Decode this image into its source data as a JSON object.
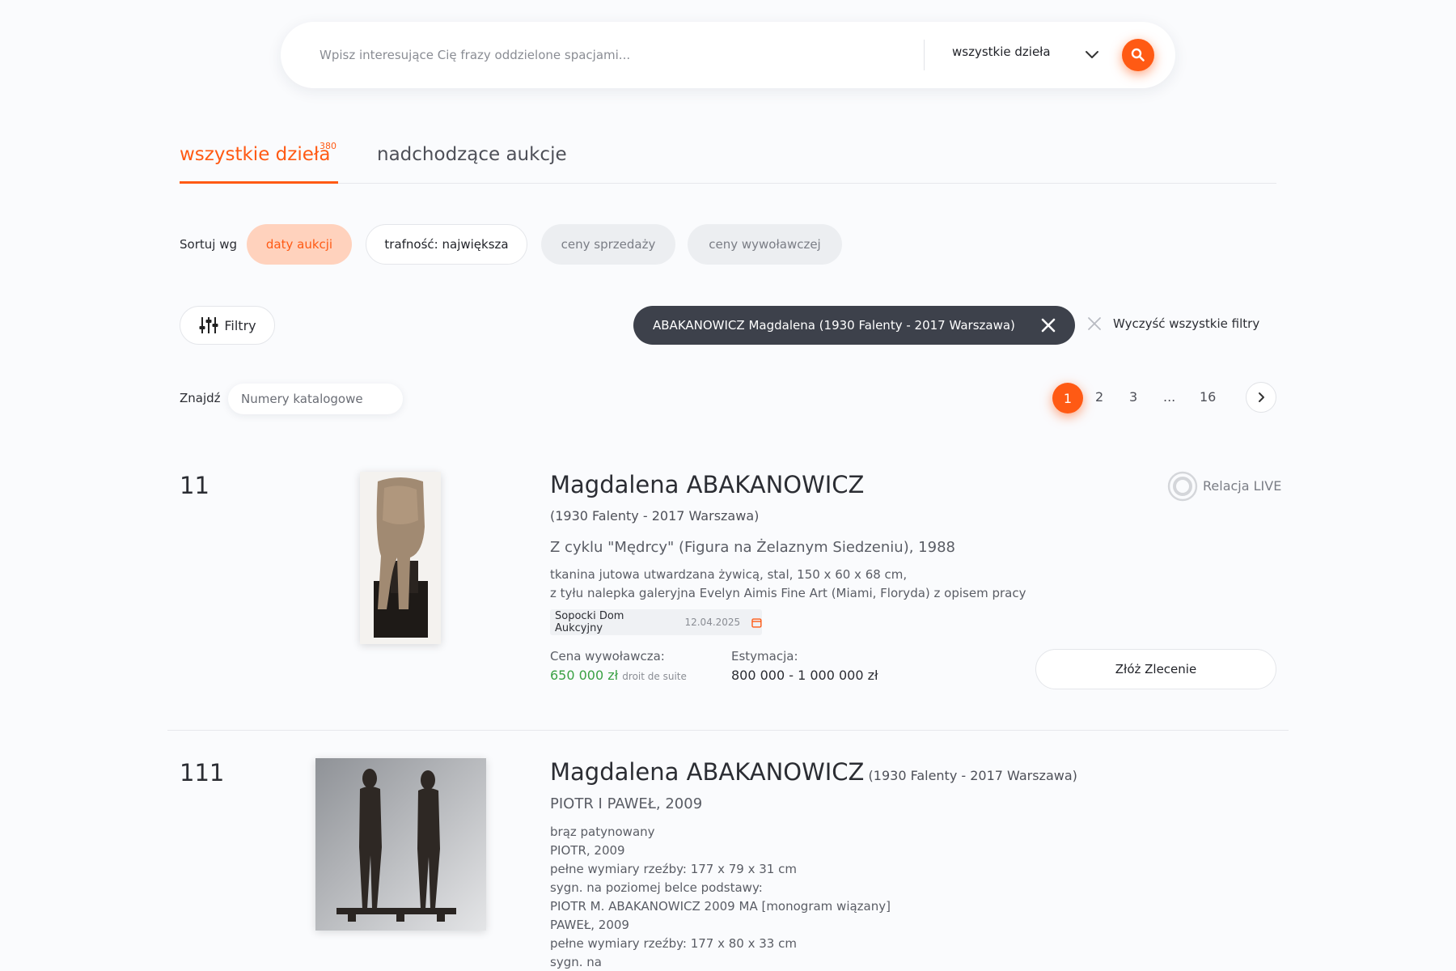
{
  "search": {
    "placeholder": "Wpisz interesujące Cię frazy oddzielone spacjami...",
    "category": "wszystkie dzieła"
  },
  "tabs": [
    {
      "label": "wszystkie dzieła",
      "count": "380",
      "active": true
    },
    {
      "label": "nadchodzące aukcje",
      "active": false
    }
  ],
  "sort": {
    "label": "Sortuj wg",
    "options": [
      {
        "label": "daty aukcji",
        "active": true
      },
      {
        "label": "trafność: największa"
      },
      {
        "label": "ceny sprzedaży"
      },
      {
        "label": "ceny wywoławczej"
      }
    ]
  },
  "filters": {
    "button_label": "Filtry",
    "active_filter": "ABAKANOWICZ Magdalena (1930 Falenty - 2017 Warszawa)",
    "clear_label": "Wyczyść wszystkie filtry"
  },
  "find": {
    "label": "Znajdź",
    "placeholder": "Numery katalogowe"
  },
  "pagination": {
    "current": "1",
    "pages": [
      "2",
      "3",
      "...",
      "16"
    ]
  },
  "listings": [
    {
      "lot": "11",
      "artist": "Magdalena ABAKANOWICZ",
      "dates": "(1930 Falenty - 2017 Warszawa)",
      "title": "Z cyklu \"Mędrcy\" (Figura na Żelaznym Siedzeniu), 1988",
      "description": [
        "tkanina jutowa utwardzana żywicą, stal, 150 x 60 x 68 cm,",
        "z tyłu nalepka galeryjna Evelyn Aimis Fine Art (Miami, Floryda) z opisem pracy"
      ],
      "auction_house": "Sopocki Dom Aukcyjny",
      "auction_date": "12.04.2025",
      "start_price_label": "Cena wywoławcza:",
      "start_price": "650 000 zł",
      "droit": "droit de suite",
      "estimate_label": "Estymacja:",
      "estimate": "800 000 - 1 000 000 zł",
      "order_label": "Złóż Zlecenie",
      "live_label": "Relacja LIVE"
    },
    {
      "lot": "111",
      "artist": "Magdalena ABAKANOWICZ",
      "dates": "(1930 Falenty - 2017 Warszawa)",
      "title": "PIOTR I PAWEŁ, 2009",
      "description": [
        "brąz patynowany",
        "PIOTR, 2009",
        "pełne wymiary rzeźby: 177 x 79 x 31 cm",
        "sygn. na poziomej belce podstawy:",
        "PIOTR M. ABAKANOWICZ 2009 MA [monogram wiązany]",
        "PAWEŁ, 2009",
        "pełne wymiary rzeźby: 177 x 80 x 33 cm",
        "sygn. na"
      ]
    }
  ],
  "colors": {
    "accent": "#ff5a14",
    "accent_soft": "#ffd2bd",
    "price_green": "#3aa144",
    "chip_dark": "#3d414b"
  }
}
